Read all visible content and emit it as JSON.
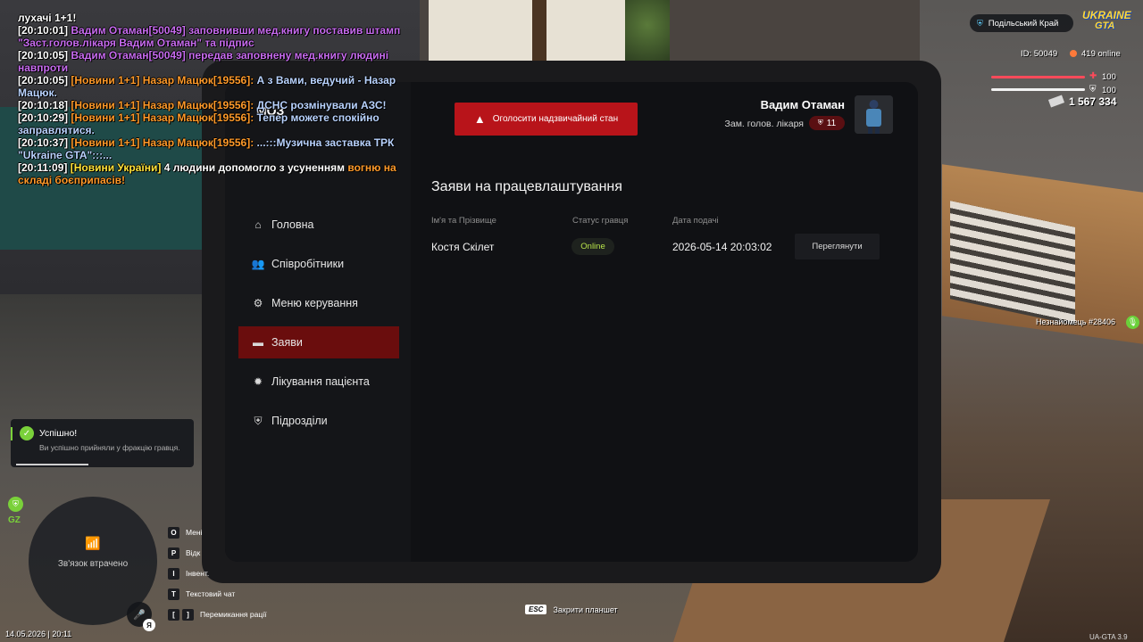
{
  "chat": [
    [
      {
        "t": "лухачі 1+1!",
        "c": "white"
      }
    ],
    [
      {
        "t": "[20:10:01] ",
        "c": "white"
      },
      {
        "t": "Вадим Отаман[50049] заповнивши мед.книгу поставив штамп \"Заст.голов.лікаря Вадим Отаман\" та підпис",
        "c": "violet"
      }
    ],
    [
      {
        "t": "[20:10:05] ",
        "c": "white"
      },
      {
        "t": "Вадим Отаман[50049] передав заповнену мед.книгу людині навпроти",
        "c": "violet"
      }
    ],
    [
      {
        "t": "[20:10:05] ",
        "c": "white"
      },
      {
        "t": "[Новини 1+1] Назар Мацюк[19556]: ",
        "c": "orange"
      },
      {
        "t": "А з Вами, ведучий - Назар Мацюк.",
        "c": "blue"
      }
    ],
    [
      {
        "t": "[20:10:18] ",
        "c": "white"
      },
      {
        "t": "[Новини 1+1] Назар Мацюк[19556]: ",
        "c": "orange"
      },
      {
        "t": "ДСНС розмінували АЗС!",
        "c": "blue"
      }
    ],
    [
      {
        "t": "[20:10:29] ",
        "c": "white"
      },
      {
        "t": "[Новини 1+1] Назар Мацюк[19556]: ",
        "c": "orange"
      },
      {
        "t": "Тепер можете спокійно заправлятися.",
        "c": "blue"
      }
    ],
    [
      {
        "t": "[20:10:37] ",
        "c": "white"
      },
      {
        "t": "[Новини 1+1] Назар Мацюк[19556]: ",
        "c": "orange"
      },
      {
        "t": "...:::Музична заставка ТРК \"Ukraine GTA\":::...",
        "c": "blue"
      }
    ],
    [
      {
        "t": "[20:11:09] ",
        "c": "white"
      },
      {
        "t": "[Новини України] ",
        "c": "yellow"
      },
      {
        "t": "4 людини допомогло з усуненням ",
        "c": "white"
      },
      {
        "t": "вогню на складі боєприпасів!",
        "c": "orange"
      }
    ]
  ],
  "tablet": {
    "org": "МОЗ",
    "nav": [
      {
        "label": "Головна",
        "icon": "home-icon",
        "glyph": "⌂"
      },
      {
        "label": "Співробітники",
        "icon": "users-icon",
        "glyph": "👥"
      },
      {
        "label": "Меню керування",
        "icon": "gear-icon",
        "glyph": "⚙"
      },
      {
        "label": "Заяви",
        "icon": "folder-icon",
        "glyph": "▬",
        "active": true
      },
      {
        "label": "Лікування пацієнта",
        "icon": "virus-icon",
        "glyph": "✹"
      },
      {
        "label": "Підрозділи",
        "icon": "shield-icon",
        "glyph": "⛨"
      }
    ],
    "emergency_label": "Оголосити надзвичайний стан",
    "user": {
      "name": "Вадим Отаман",
      "role": "Зам. голов. лікаря",
      "rank": "11"
    },
    "section_title": "Заяви на працевлаштування",
    "columns": {
      "name": "Ім'я та Прізвище",
      "status": "Статус гравця",
      "date": "Дата подачі"
    },
    "rows": [
      {
        "name": "Костя Скілет",
        "status": "Online",
        "date": "2026-05-14 20:03:02",
        "action": "Переглянути"
      }
    ]
  },
  "hud": {
    "region": "Подільський Край",
    "logo_top": "UKRAINE",
    "logo_bottom": "GTA",
    "id": "ID: 50049",
    "online": "419 online",
    "health": "100",
    "armor": "100",
    "money": "1 567 334",
    "nearby": "Незнайомець #28406",
    "gz": "GZ",
    "connection_lost": "Зв'язок втрачено",
    "lang": "Я",
    "datetime": "14.05.2026 | 20:11",
    "version": "UA-GTA 3.9",
    "colors": {
      "health": "#ff4a5a",
      "accent": "#b8141a",
      "online": "#b7e34a",
      "success": "#7ad13a"
    }
  },
  "notification": {
    "title": "Успішно!",
    "message": "Ви успішно прийняли у фракцію гравця.",
    "progress": 0.42
  },
  "keybinds": [
    {
      "keys": [
        "O"
      ],
      "label": "Мені"
    },
    {
      "keys": [
        "P"
      ],
      "label": "Відк"
    },
    {
      "keys": [
        "I"
      ],
      "label": "Інвент."
    },
    {
      "keys": [
        "T"
      ],
      "label": "Текстовий чат"
    },
    {
      "keys": [
        "[",
        "]"
      ],
      "label": "Перемикання рації"
    }
  ],
  "esc_hint": {
    "key": "ESC",
    "label": "Закрити планшет"
  }
}
